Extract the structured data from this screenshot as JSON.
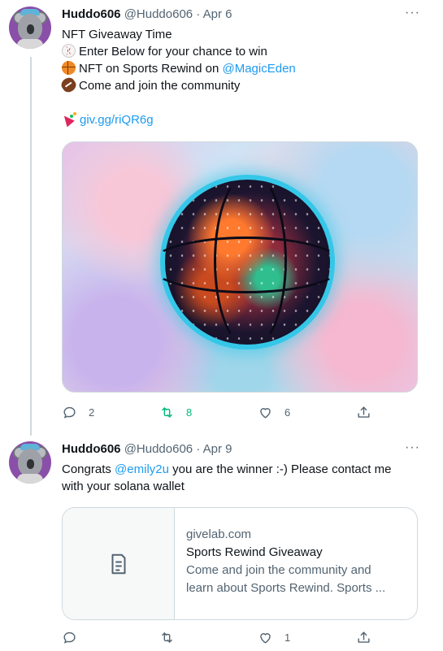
{
  "tweets": [
    {
      "author_name": "Huddo606",
      "handle": "@Huddo606",
      "separator": "·",
      "date": "Apr 6",
      "more_label": "···",
      "text_lines": {
        "l1": "NFT Giveaway Time",
        "l2": "Enter Below for your chance to win",
        "l3_pre": "NFT on Sports Rewind on ",
        "l3_mention": "@MagicEden",
        "l4": "Come and join the community",
        "l5_link": "giv.gg/riQR6g"
      },
      "emojis": [
        "baseball-emoji",
        "basketball-emoji",
        "football-emoji",
        "party-popper-emoji"
      ],
      "media": {
        "subject": "psychedelic-basketball-artwork",
        "ring_color": "#35c7e8"
      },
      "stats": {
        "replies": "2",
        "retweets": "8",
        "likes": "6",
        "share": ""
      },
      "retweet_color": "#00ba7c"
    },
    {
      "author_name": "Huddo606",
      "handle": "@Huddo606",
      "separator": "·",
      "date": "Apr 9",
      "more_label": "···",
      "text_lines": {
        "l1_pre": "Congrats ",
        "l1_mention": "@emily2u",
        "l1_post": " you are the winner :-) Please contact me",
        "l2": "with your solana wallet"
      },
      "card": {
        "domain": "givelab.com",
        "title": "Sports Rewind Giveaway",
        "desc_line1": "Come and join the community and",
        "desc_line2": "learn about Sports Rewind. Sports ...",
        "thumb_icon": "document-icon"
      },
      "stats": {
        "replies": "",
        "retweets": "",
        "likes": "1",
        "share": ""
      }
    }
  ],
  "colors": {
    "link": "#1d9bf0",
    "secondary_text": "#536471",
    "border": "#cfd9de"
  }
}
